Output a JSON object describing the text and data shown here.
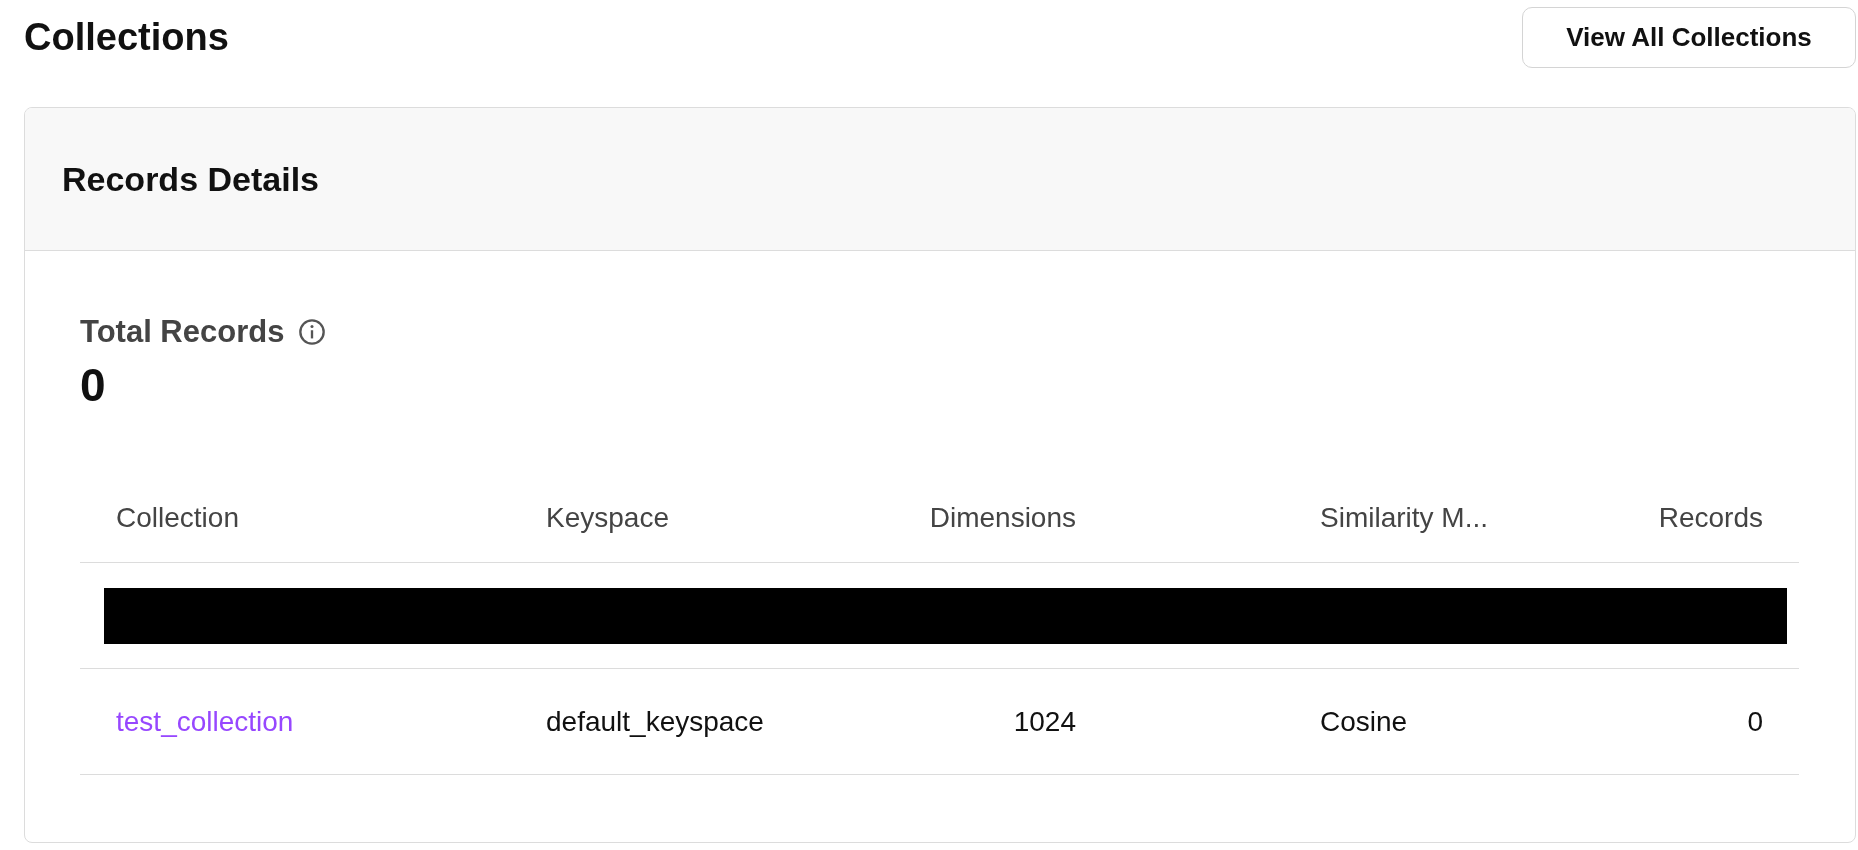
{
  "page": {
    "title": "Collections",
    "action_button": "View All Collections"
  },
  "card": {
    "title": "Records Details",
    "total": {
      "label": "Total Records",
      "value": "0"
    },
    "table": {
      "columns": [
        "Collection",
        "Keyspace",
        "Dimensions",
        "Similarity M...",
        "Records"
      ],
      "rows": [
        {
          "kind": "redacted"
        },
        {
          "kind": "data",
          "collection": "test_collection",
          "keyspace": "default_keyspace",
          "dimensions": "1024",
          "similarity": "Cosine",
          "records": "0"
        }
      ]
    }
  }
}
